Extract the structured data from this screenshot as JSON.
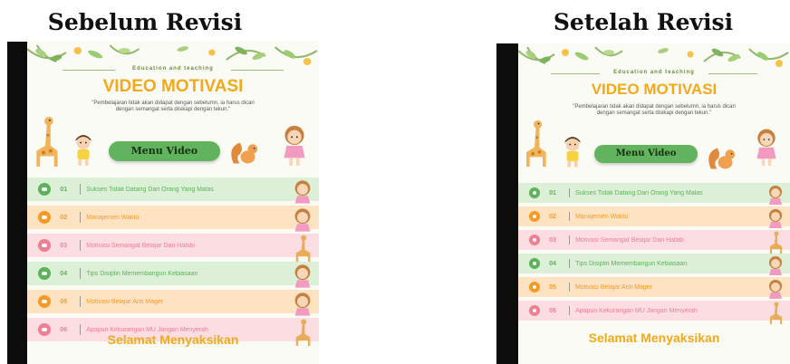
{
  "captions": {
    "before": "Sebelum Revisi",
    "after": "Setelah Revisi"
  },
  "app": {
    "subtitle": "Education and teaching",
    "title": "VIDEO MOTIVASI",
    "quote": "\"Pembelajaran tidak akan didapat dengan sebelumn, ia harus dicari dengan semangat serta disikapi dengan tekun.\"",
    "menu_button": "Menu Video",
    "closing": "Selamat Menyaksikan",
    "items": [
      {
        "num": "01",
        "label": "Sukses Tidak Datang Dari Orang Yang Malas",
        "theme": "green",
        "icon": "girl-icon"
      },
      {
        "num": "02",
        "label": "Manajemen Waktu",
        "theme": "orange",
        "icon": "girl-icon"
      },
      {
        "num": "03",
        "label": "Motivasi Semangat Belajar Dari Habibi",
        "theme": "pink",
        "icon": "giraffe-icon"
      },
      {
        "num": "04",
        "label": "Tips Disiplin Memembangun Kebiasaan",
        "theme": "green",
        "icon": "girl-icon"
      },
      {
        "num": "05",
        "label": "Motivasi Belajar Anti Mager",
        "theme": "orange",
        "icon": "girl-icon"
      },
      {
        "num": "06",
        "label": "Apapun Kekurangan MU Jangan Menyerah",
        "theme": "pink",
        "icon": "giraffe-icon"
      }
    ]
  },
  "colors": {
    "green_bg": "#dcefd7",
    "green_dot": "#5fb15c",
    "orange_bg": "#fde3c2",
    "orange_dot": "#f59a25",
    "pink_bg": "#fbdde2",
    "pink_dot": "#ef7f95",
    "accent_title": "#f2a91a",
    "menu_green": "#62b35e"
  }
}
